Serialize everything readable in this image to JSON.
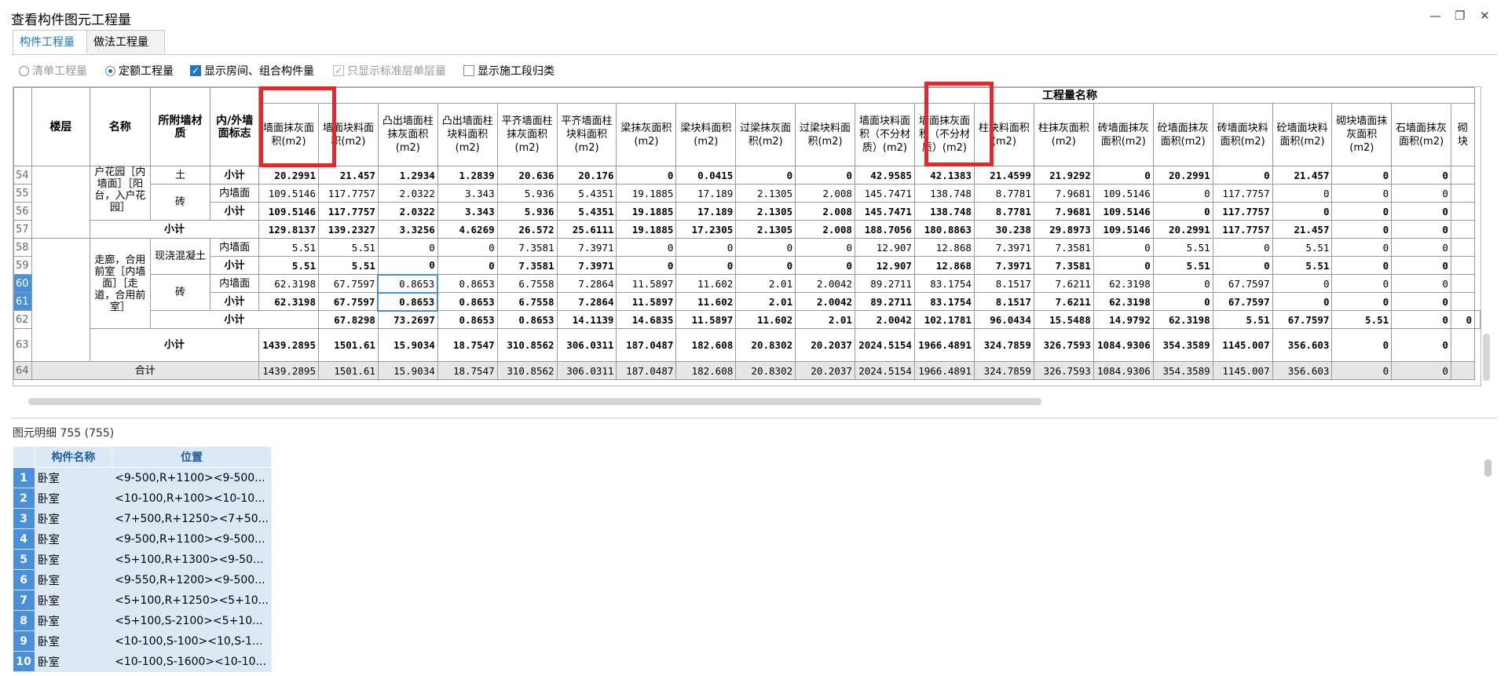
{
  "window": {
    "title": "查看构件图元工程量",
    "minimize": "—",
    "restore": "❐",
    "close": "✕"
  },
  "tabs": [
    "构件工程量",
    "做法工程量"
  ],
  "options": [
    {
      "label": "清单工程量",
      "kind": "radio",
      "checked": false,
      "disabled": true
    },
    {
      "label": "定额工程量",
      "kind": "radio",
      "checked": true,
      "disabled": false
    },
    {
      "label": "显示房间、组合构件量",
      "kind": "checkbox",
      "checked": true,
      "disabled": false
    },
    {
      "label": "只显示标准层单层量",
      "kind": "checkbox",
      "checked": true,
      "disabled": true
    },
    {
      "label": "显示施工段归类",
      "kind": "checkbox",
      "checked": false,
      "disabled": false
    }
  ],
  "grid": {
    "group_header": "工程量名称",
    "fixed_headers": [
      "楼层",
      "名称",
      "所附墙材质",
      "内/外墙面标志"
    ],
    "columns": [
      "墙面抹灰面积(m2)",
      "墙面块料面积(m2)",
      "凸出墙面柱抹灰面积(m2)",
      "凸出墙面柱块料面积(m2)",
      "平齐墙面柱抹灰面积(m2)",
      "平齐墙面柱块料面积(m2)",
      "梁抹灰面积(m2)",
      "梁块料面积(m2)",
      "过梁抹灰面积(m2)",
      "过梁块料面积(m2)",
      "墙面块料面积（不分材质）(m2)",
      "墙面抹灰面积（不分材质）(m2)",
      "柱块料面积(m2)",
      "柱抹灰面积(m2)",
      "砖墙面抹灰面积(m2)",
      "砼墙面抹灰面积(m2)",
      "砖墙面块料面积(m2)",
      "砼墙面块料面积(m2)",
      "砌块墙面抹灰面积(m2)",
      "石墙面抹灰面积(m2)",
      "砌块"
    ],
    "name_a": "阳台，入户花园［内墙面］［阳台，入户花园］",
    "name_a_visible": "户花园［内墙面］［阳台，入户花园］",
    "name_b": "走廊，合用前室［内墙面］［走道，合用前室］",
    "mat_concrete": "现浇混凝土",
    "mat_concrete_tail": "土",
    "mat_brick": "砖",
    "inner": "内墙面",
    "subtotal": "小计",
    "total": "合计",
    "rows": {
      "r54": {
        "num": "54",
        "values": [
          "20.2991",
          "21.457",
          "1.2934",
          "1.2839",
          "20.636",
          "20.176",
          "0",
          "0.0415",
          "0",
          "0",
          "42.9585",
          "42.1383",
          "21.4599",
          "21.9292",
          "0",
          "20.2991",
          "0",
          "21.457",
          "0",
          "0",
          ""
        ]
      },
      "r55": {
        "num": "55",
        "values": [
          "109.5146",
          "117.7757",
          "2.0322",
          "3.343",
          "5.936",
          "5.4351",
          "19.1885",
          "17.189",
          "2.1305",
          "2.008",
          "145.7471",
          "138.748",
          "8.7781",
          "7.9681",
          "109.5146",
          "0",
          "117.7757",
          "0",
          "0",
          "0",
          ""
        ]
      },
      "r56": {
        "num": "56",
        "values": [
          "109.5146",
          "117.7757",
          "2.0322",
          "3.343",
          "5.936",
          "5.4351",
          "19.1885",
          "17.189",
          "2.1305",
          "2.008",
          "145.7471",
          "138.748",
          "8.7781",
          "7.9681",
          "109.5146",
          "0",
          "117.7757",
          "0",
          "0",
          "0",
          ""
        ]
      },
      "r57": {
        "num": "57",
        "values": [
          "129.8137",
          "139.2327",
          "3.3256",
          "4.6269",
          "26.572",
          "25.6111",
          "19.1885",
          "17.2305",
          "2.1305",
          "2.008",
          "188.7056",
          "180.8863",
          "30.238",
          "29.8973",
          "109.5146",
          "20.2991",
          "117.7757",
          "21.457",
          "0",
          "0",
          ""
        ]
      },
      "r58": {
        "num": "58",
        "values": [
          "5.51",
          "5.51",
          "0",
          "0",
          "7.3581",
          "7.3971",
          "0",
          "0",
          "0",
          "0",
          "12.907",
          "12.868",
          "7.3971",
          "7.3581",
          "0",
          "5.51",
          "0",
          "5.51",
          "0",
          "0",
          ""
        ]
      },
      "r59": {
        "num": "59",
        "values": [
          "5.51",
          "5.51",
          "0",
          "0",
          "7.3581",
          "7.3971",
          "0",
          "0",
          "0",
          "0",
          "12.907",
          "12.868",
          "7.3971",
          "7.3581",
          "0",
          "5.51",
          "0",
          "5.51",
          "0",
          "0",
          ""
        ]
      },
      "r60": {
        "num": "60",
        "values": [
          "62.3198",
          "67.7597",
          "0.8653",
          "0.8653",
          "6.7558",
          "7.2864",
          "11.5897",
          "11.602",
          "2.01",
          "2.0042",
          "89.2711",
          "83.1754",
          "8.1517",
          "7.6211",
          "62.3198",
          "0",
          "67.7597",
          "0",
          "0",
          "0",
          ""
        ]
      },
      "r61": {
        "num": "61",
        "values": [
          "62.3198",
          "67.7597",
          "0.8653",
          "0.8653",
          "6.7558",
          "7.2864",
          "11.5897",
          "11.602",
          "2.01",
          "2.0042",
          "89.2711",
          "83.1754",
          "8.1517",
          "7.6211",
          "62.3198",
          "0",
          "67.7597",
          "0",
          "0",
          "0",
          ""
        ]
      },
      "r62": {
        "num": "62",
        "values": [
          "67.8298",
          "73.2697",
          "0.8653",
          "0.8653",
          "14.1139",
          "14.6835",
          "11.5897",
          "11.602",
          "2.01",
          "2.0042",
          "102.1781",
          "96.0434",
          "15.5488",
          "14.9792",
          "62.3198",
          "5.51",
          "67.7597",
          "5.51",
          "0",
          "0",
          ""
        ]
      },
      "r63": {
        "num": "63",
        "values": [
          "1439.2895",
          "1501.61",
          "15.9034",
          "18.7547",
          "310.8562",
          "306.0311",
          "187.0487",
          "182.608",
          "20.8302",
          "20.2037",
          "2024.5154",
          "1966.4891",
          "324.7859",
          "326.7593",
          "1084.9306",
          "354.3589",
          "1145.007",
          "356.603",
          "0",
          "0",
          ""
        ]
      },
      "r64": {
        "num": "64",
        "values": [
          "1439.2895",
          "1501.61",
          "15.9034",
          "18.7547",
          "310.8562",
          "306.0311",
          "187.0487",
          "182.608",
          "20.8302",
          "20.2037",
          "2024.5154",
          "1966.4891",
          "324.7859",
          "326.7593",
          "1084.9306",
          "354.3589",
          "1145.007",
          "356.603",
          "0",
          "0",
          ""
        ]
      }
    }
  },
  "detail": {
    "title": "图元明细  755 (755)",
    "headers": [
      "构件名称",
      "位置"
    ],
    "rows": [
      {
        "n": "1",
        "name": "卧室",
        "pos": "<9-500,R+1100><9-500..."
      },
      {
        "n": "2",
        "name": "卧室",
        "pos": "<10-100,R+100><10-10..."
      },
      {
        "n": "3",
        "name": "卧室",
        "pos": "<7+500,R+1250><7+50..."
      },
      {
        "n": "4",
        "name": "卧室",
        "pos": "<9-500,R+1100><9-500..."
      },
      {
        "n": "5",
        "name": "卧室",
        "pos": "<5+100,R+1300><9-50..."
      },
      {
        "n": "6",
        "name": "卧室",
        "pos": "<9-550,R+1200><9-500..."
      },
      {
        "n": "7",
        "name": "卧室",
        "pos": "<5+100,R+1250><5+10..."
      },
      {
        "n": "8",
        "name": "卧室",
        "pos": "<5+100,S-2100><5+10..."
      },
      {
        "n": "9",
        "name": "卧室",
        "pos": "<10-100,S-100><10,S-1..."
      },
      {
        "n": "10",
        "name": "卧室",
        "pos": "<10-100,S-1600><10-10..."
      }
    ]
  },
  "colors": {
    "accent": "#1a78c2",
    "highlight": "#e8262b",
    "selection": "#4a90d8"
  }
}
